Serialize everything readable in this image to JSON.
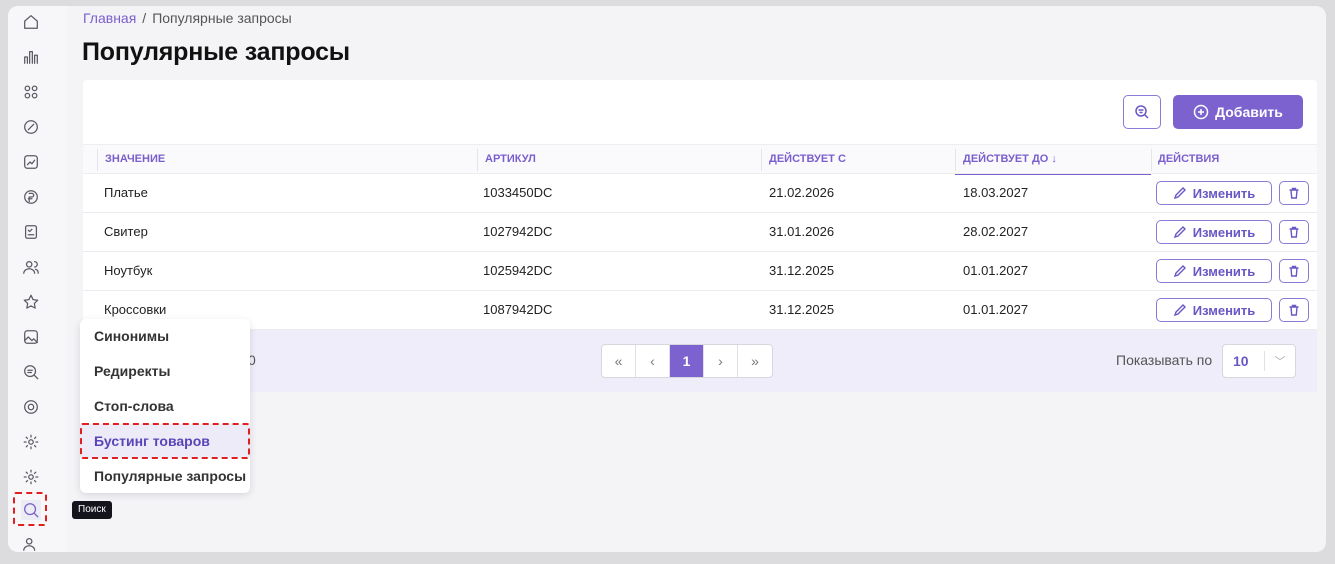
{
  "breadcrumb": {
    "home": "Главная",
    "separator": "/",
    "current": "Популярные запросы"
  },
  "page_title": "Популярные запросы",
  "toolbar": {
    "add_label": "Добавить"
  },
  "table": {
    "columns": [
      "ЗНАЧЕНИЕ",
      "АРТИКУЛ",
      "ДЕЙСТВУЕТ С",
      "ДЕЙСТВУЕТ ДО ↓",
      "ДЕЙСТВИЯ"
    ],
    "rows": [
      {
        "value": "Платье",
        "sku": "1033450DC",
        "from": "21.02.2026",
        "to": "18.03.2027"
      },
      {
        "value": "Свитер",
        "sku": "1027942DC",
        "from": "31.01.2026",
        "to": "28.02.2027"
      },
      {
        "value": "Ноутбук",
        "sku": "1025942DC",
        "from": "31.12.2025",
        "to": "01.01.2027"
      },
      {
        "value": "Кроссовки",
        "sku": "1087942DC",
        "from": "31.12.2025",
        "to": "01.01.2027"
      }
    ],
    "edit_label": "Изменить"
  },
  "footer": {
    "total_fragment": "0",
    "pagination": {
      "first": "«",
      "prev": "‹",
      "current": "1",
      "next": "›",
      "last": "»"
    },
    "per_page_label": "Показывать по",
    "per_page_value": "10"
  },
  "menu": {
    "items": [
      "Синонимы",
      "Редиректы",
      "Стоп-слова",
      "Бустинг товаров",
      "Популярные запросы"
    ]
  },
  "tooltip": "Поиск",
  "accent_color": "#7b62cf",
  "highlight_color": "#e02020"
}
